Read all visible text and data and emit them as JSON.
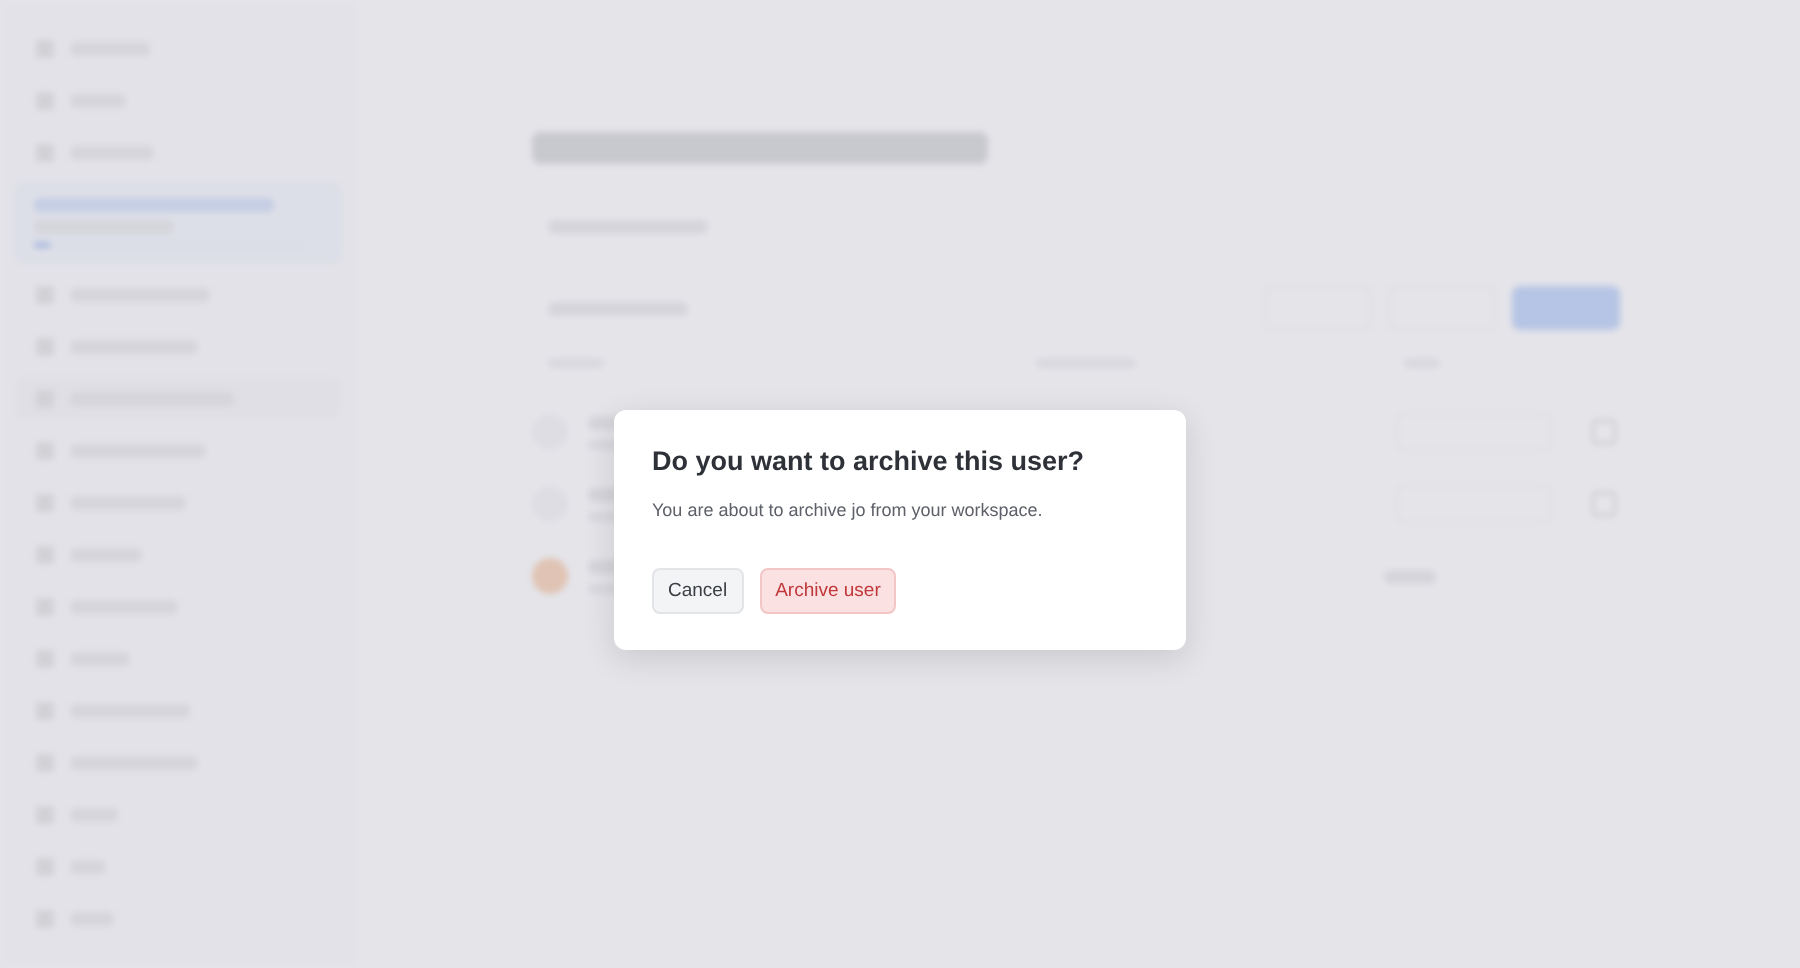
{
  "dialog": {
    "title": "Do you want to archive this user?",
    "message": "You are about to archive jo from your workspace.",
    "buttons": [
      {
        "label": "Cancel",
        "kind": "secondary"
      },
      {
        "label": "Archive user",
        "kind": "danger"
      }
    ]
  }
}
